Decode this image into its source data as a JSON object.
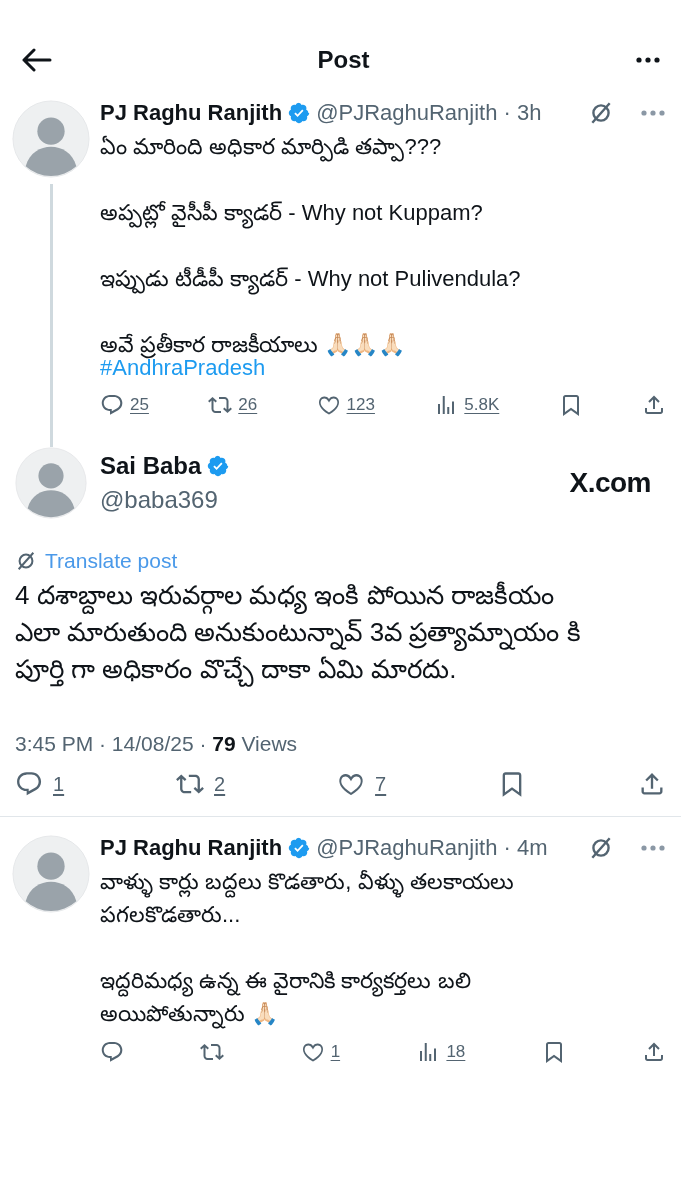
{
  "header": {
    "title": "Post"
  },
  "tweets": [
    {
      "kind": "parent",
      "author": {
        "name": "PJ Raghu Ranjith",
        "verified": true,
        "meta": "@PJRaghuRanjith · 3h"
      },
      "paragraphs": [
        "ఏం మారింది అధికార మార్పిడి తప్పా???",
        "అప్పట్లో వైసీపీ క్యాడర్ - Why not Kuppam?",
        "ఇప్పుడు టీడీపీ క్యాడర్ - Why not Pulivendula?",
        "అవే ప్రతీకార రాజకీయాలు 🙏🏻🙏🏻🙏🏻\n"
      ],
      "hashtag": "#AndhraPradesh",
      "actions": [
        {
          "kind": "reply",
          "count": "25"
        },
        {
          "kind": "repost",
          "count": "26"
        },
        {
          "kind": "like",
          "count": "123"
        },
        {
          "kind": "views",
          "count": "5.8K"
        },
        {
          "kind": "bookmark"
        },
        {
          "kind": "share"
        }
      ]
    },
    {
      "kind": "main",
      "author": {
        "name": "Sai Baba",
        "verified": true,
        "meta": "@baba369"
      },
      "source": "X.com",
      "translate": "Translate post",
      "paragraphs": [
        "4 దశాబ్దాలు ఇరువర్గాల మధ్య ఇంకి పోయిన రాజకీయం ఎలా మారుతుంది అనుకుంటున్నావ్ 3వ ప్రత్యామ్నాయం కి పూర్తి గా అధికారం వొచ్చే దాకా ఏమి మారదు."
      ],
      "timestamp": "3:45 PM · 14/08/25 · **79** Views",
      "actions": [
        {
          "kind": "reply",
          "count": "1"
        },
        {
          "kind": "repost",
          "count": "2"
        },
        {
          "kind": "like",
          "count": "7"
        },
        {
          "kind": "bookmark"
        },
        {
          "kind": "share"
        }
      ]
    },
    {
      "kind": "reply",
      "author": {
        "name": "PJ Raghu Ranjith",
        "verified": true,
        "meta": "@PJRaghuRanjith · 4m"
      },
      "paragraphs": [
        "వాళ్ళు కార్లు బద్దలు కొడతారు, వీళ్ళు తలకాయలు పగలకొడతారు...",
        "ఇద్దరిమధ్య ఉన్న ఈ వైరానికి కార్యకర్తలు బలి అయిపోతున్నారు 🙏🏻"
      ],
      "actions": [
        {
          "kind": "reply"
        },
        {
          "kind": "repost"
        },
        {
          "kind": "like",
          "count": "1"
        },
        {
          "kind": "views",
          "count": "18"
        },
        {
          "kind": "bookmark"
        },
        {
          "kind": "share"
        }
      ]
    }
  ]
}
